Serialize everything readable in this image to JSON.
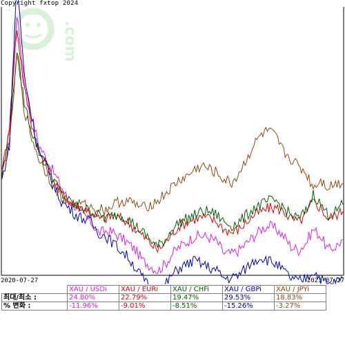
{
  "copyright": "Copyright fxtop 2024",
  "watermark": "fxtop.com",
  "colors": {
    "XAU / USDi": "#e020e0",
    "XAU / EURi": "#e00000",
    "XAU / CHFi": "#006000",
    "XAU / GBPi": "#0000c0",
    "XAU / JPYi": "#8b4a10"
  },
  "chart_data": {
    "type": "line",
    "x_start": "2020-07-27",
    "x_end": "2021-07-27",
    "grid": false,
    "legend": "table below chart",
    "series": [
      {
        "name": "XAU / USDi",
        "max_pct": 24.8,
        "min_pct": -11.96,
        "values": [
          2.0,
          8.0,
          24.8,
          15.0,
          10.0,
          6.0,
          4.0,
          2.0,
          0.0,
          -2.0,
          -2.8,
          -4.0,
          -5.0,
          -6.5,
          -6.3,
          -6.5,
          -7.2,
          -8.0,
          -9.0,
          -10.5,
          -11.2,
          -11.96,
          -11.0,
          -9.5,
          -8.5,
          -7.8,
          -7.0,
          -7.0,
          -7.2,
          -7.8,
          -9.5,
          -9.5,
          -9.0,
          -8.0,
          -7.0,
          -6.0,
          -5.5,
          -6.0,
          -7.0,
          -8.5,
          -9.0,
          -8.0,
          -6.0,
          -7.0,
          -9.0,
          -8.5,
          -7.5
        ]
      },
      {
        "name": "XAU / EURi",
        "max_pct": 22.79,
        "min_pct": -9.01,
        "values": [
          2.0,
          9.0,
          22.79,
          14.0,
          9.0,
          5.0,
          3.0,
          1.0,
          -1.0,
          -2.0,
          -2.8,
          -3.0,
          -3.5,
          -4.5,
          -4.5,
          -4.0,
          -4.5,
          -5.0,
          -6.0,
          -7.0,
          -8.0,
          -9.01,
          -8.0,
          -6.5,
          -5.5,
          -5.0,
          -4.5,
          -4.3,
          -4.5,
          -5.0,
          -6.0,
          -6.5,
          -6.0,
          -5.0,
          -4.0,
          -3.5,
          -3.0,
          -3.0,
          -3.5,
          -4.5,
          -5.0,
          -4.0,
          -2.0,
          -3.0,
          -4.5,
          -4.0,
          -3.5
        ]
      },
      {
        "name": "XAU / CHFi",
        "max_pct": 19.47,
        "min_pct": -8.51,
        "values": [
          2.0,
          7.0,
          19.47,
          12.0,
          8.0,
          5.0,
          3.0,
          1.0,
          -1.0,
          -2.0,
          -2.8,
          -3.0,
          -3.5,
          -4.0,
          -4.5,
          -4.0,
          -4.0,
          -4.5,
          -5.5,
          -6.5,
          -7.5,
          -8.51,
          -7.5,
          -6.0,
          -5.0,
          -4.5,
          -4.0,
          -3.5,
          -3.5,
          -4.0,
          -5.0,
          -5.5,
          -5.0,
          -4.0,
          -3.0,
          -2.5,
          -2.0,
          -2.0,
          -3.0,
          -4.0,
          -4.5,
          -3.5,
          -1.0,
          -2.5,
          -4.0,
          -3.5,
          -2.5
        ]
      },
      {
        "name": "XAU / GBPi",
        "max_pct": 29.53,
        "min_pct": -15.26,
        "values": [
          1.0,
          6.0,
          29.53,
          16.0,
          10.0,
          5.0,
          3.0,
          0.0,
          -2.0,
          -3.0,
          -4.0,
          -4.5,
          -5.0,
          -6.5,
          -7.0,
          -8.0,
          -9.0,
          -10.0,
          -11.5,
          -13.0,
          -14.5,
          -15.26,
          -14.0,
          -12.5,
          -11.5,
          -11.0,
          -10.5,
          -11.0,
          -11.5,
          -12.0,
          -13.0,
          -13.0,
          -12.5,
          -11.5,
          -10.5,
          -10.0,
          -10.5,
          -11.0,
          -12.0,
          -13.0,
          -13.5,
          -13.0,
          -12.0,
          -13.0,
          -14.0,
          -13.5,
          -13.0
        ]
      },
      {
        "name": "XAU / JPYi",
        "max_pct": 18.83,
        "min_pct": -3.27,
        "values": [
          2.0,
          6.0,
          18.83,
          11.0,
          7.0,
          4.0,
          2.0,
          0.0,
          -1.5,
          -2.0,
          -2.5,
          -2.5,
          -3.0,
          -3.0,
          -3.27,
          -2.5,
          -2.0,
          -2.0,
          -2.5,
          -3.0,
          -2.5,
          -2.0,
          -1.0,
          0.0,
          1.0,
          1.5,
          2.5,
          3.0,
          2.5,
          2.0,
          1.0,
          0.5,
          2.0,
          4.0,
          6.0,
          7.5,
          8.0,
          7.0,
          5.0,
          4.0,
          3.0,
          2.0,
          0.0,
          1.0,
          0.0,
          0.5,
          0.5
        ]
      }
    ],
    "ylim": [
      -12.5,
      25.5
    ]
  },
  "table": {
    "row1_label": "최대/최소 :",
    "row2_label": "% 변화 :",
    "columns": [
      {
        "name": "XAU / USDi",
        "maxmin": "24.80%",
        "change": "-11.96%"
      },
      {
        "name": "XAU / EURi",
        "maxmin": "22.79%",
        "change": "-9.01%"
      },
      {
        "name": "XAU / CHFi",
        "maxmin": "19.47%",
        "change": "-8.51%"
      },
      {
        "name": "XAU / GBPi",
        "maxmin": "29.53%",
        "change": "-15.26%"
      },
      {
        "name": "XAU / JPYi",
        "maxmin": "18.83%",
        "change": "-3.27%"
      }
    ]
  }
}
